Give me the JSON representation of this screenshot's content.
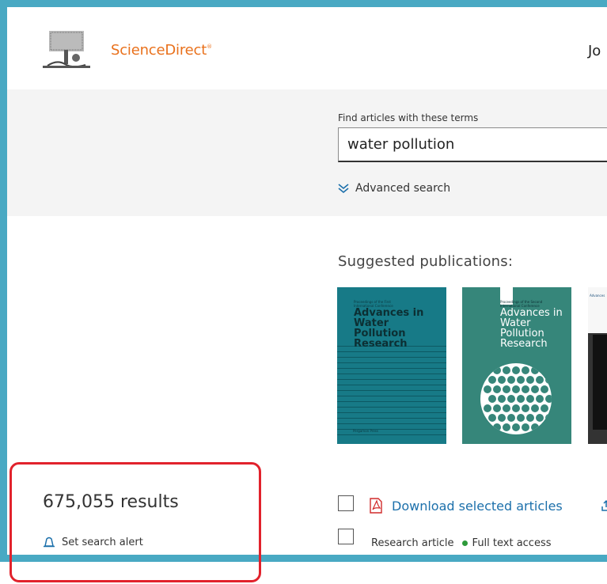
{
  "header": {
    "brand": "ScienceDirect",
    "brand_mark": "®",
    "user_initials": "Jo",
    "logo_icon": "elsevier-tree-logo-icon"
  },
  "search": {
    "label": "Find articles with these terms",
    "value": "water pollution",
    "advanced_label": "Advanced search",
    "advanced_icon": "chevron-double-down-icon"
  },
  "suggested": {
    "title": "Suggested publications:",
    "covers": [
      {
        "title_lines": [
          "Advances in",
          "Water",
          "Pollution",
          "Research"
        ],
        "color": "#177a87"
      },
      {
        "title_lines": [
          "Advances in",
          "Water",
          "Pollution",
          "Research"
        ],
        "color": "#36867a"
      },
      {
        "title_lines": [
          "Advances"
        ],
        "color": "#333333"
      }
    ]
  },
  "results": {
    "count": "675,055 results",
    "alert_label": "Set search alert",
    "alert_icon": "bell-icon"
  },
  "toolbar": {
    "download_label": "Download selected articles",
    "download_icon": "pdf-icon",
    "export_icon": "export-icon"
  },
  "first_result": {
    "type": "Research article",
    "access": "Full text access"
  },
  "colors": {
    "brand": "#e9711c",
    "link": "#1c70ab",
    "frame": "#49a9c3",
    "highlight": "#e1222c",
    "access_dot": "#2d9a3a"
  }
}
